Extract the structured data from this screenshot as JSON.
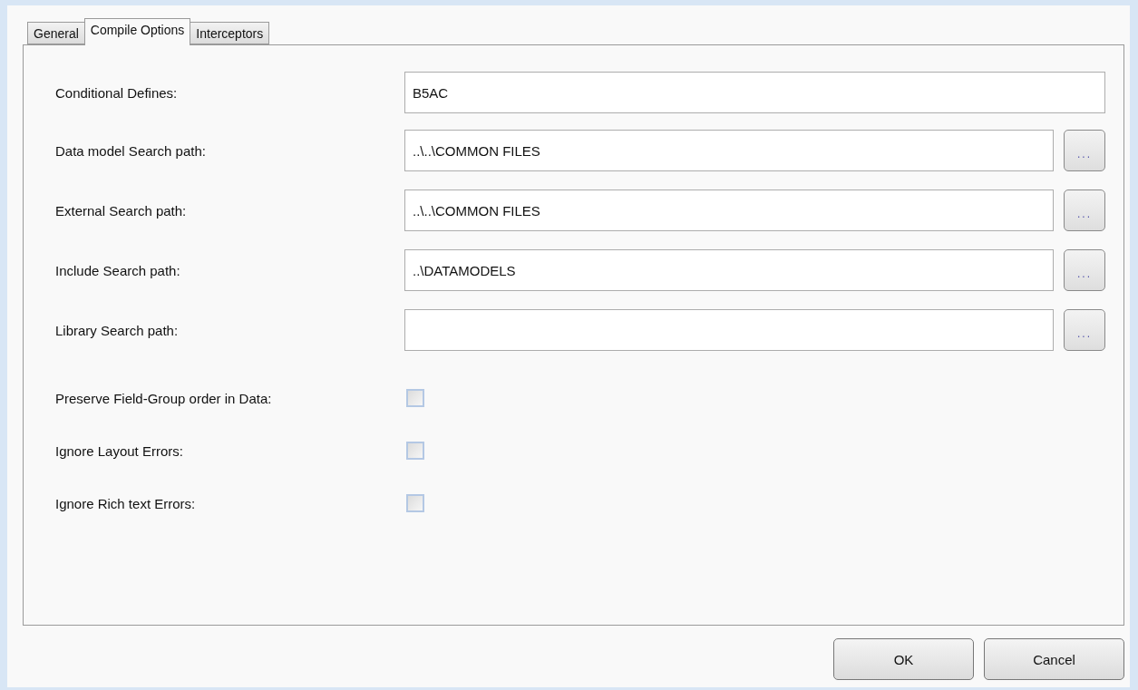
{
  "tabs": [
    {
      "label": "General",
      "selected": false
    },
    {
      "label": "Compile Options",
      "selected": true
    },
    {
      "label": "Interceptors",
      "selected": false
    }
  ],
  "fields": [
    {
      "label": "Conditional Defines:",
      "value": "B5AC"
    },
    {
      "label": "Data model Search path:",
      "value": "..\\..\\COMMON FILES",
      "browse_label": "..."
    },
    {
      "label": "External Search path:",
      "value": "..\\..\\COMMON FILES",
      "browse_label": "..."
    },
    {
      "label": "Include Search path:",
      "value": "..\\DATAMODELS",
      "browse_label": "..."
    },
    {
      "label": "Library Search path:",
      "browse_label": "..."
    }
  ],
  "options": [
    {
      "label": "Preserve Field-Group order in Data:",
      "checked": false
    },
    {
      "label": "Ignore Layout Errors:",
      "checked": false
    },
    {
      "label": "Ignore Rich text Errors:",
      "checked": false
    }
  ],
  "buttons": [
    "OK",
    "Cancel"
  ]
}
